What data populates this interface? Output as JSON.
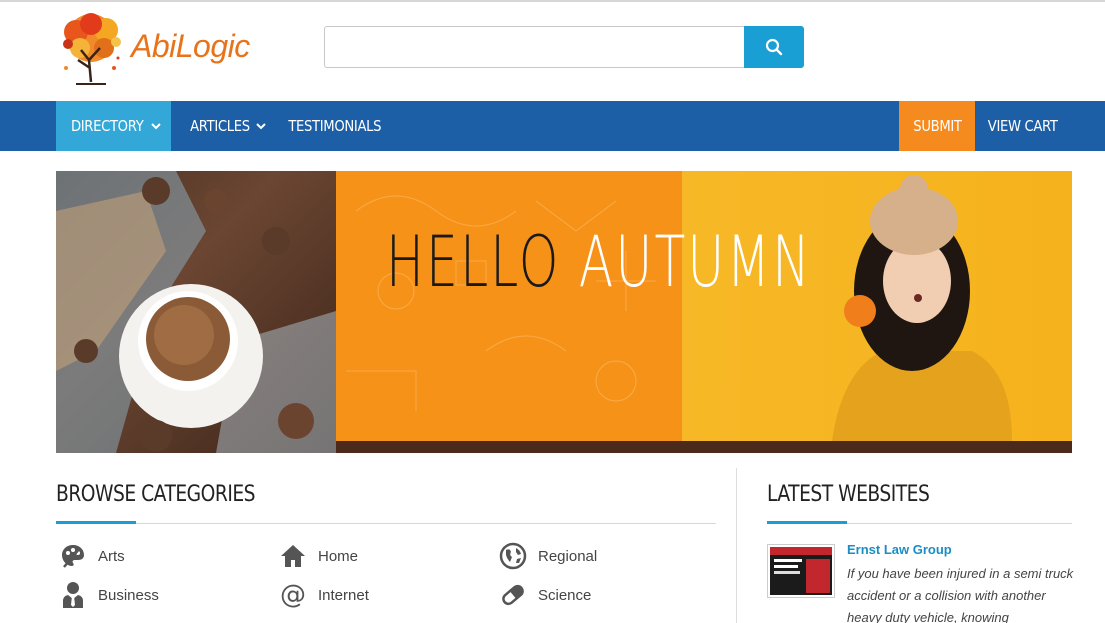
{
  "header": {
    "logo_text": "AbiLogic",
    "search": {
      "value": "",
      "placeholder": "",
      "icon": "search-icon"
    }
  },
  "nav": {
    "items": [
      {
        "label": "DIRECTORY",
        "dropdown": true,
        "active": true
      },
      {
        "label": "ARTICLES",
        "dropdown": true
      },
      {
        "label": "TESTIMONIALS"
      },
      {
        "label": "SUBMIT"
      },
      {
        "label": "VIEW CART"
      }
    ]
  },
  "banner": {
    "word1": "HELLO",
    "word2": "AUTUMN"
  },
  "categories": {
    "title": "BROWSE CATEGORIES",
    "items": [
      {
        "label": "Arts",
        "icon": "palette-icon"
      },
      {
        "label": "Home",
        "icon": "house-icon"
      },
      {
        "label": "Regional",
        "icon": "globe-icon"
      },
      {
        "label": "Business",
        "icon": "businessman-icon"
      },
      {
        "label": "Internet",
        "icon": "at-sign-icon"
      },
      {
        "label": "Science",
        "icon": "pill-icon"
      }
    ]
  },
  "latest": {
    "title": "LATEST WEBSITES",
    "items": [
      {
        "title": "Ernst Law Group",
        "description": "If you have been injured in a semi truck accident or a collision with another heavy duty vehicle, knowing"
      }
    ]
  },
  "colors": {
    "nav_bg": "#1d5fa6",
    "nav_active": "#33a8d8",
    "submit_bg": "#f58a1f",
    "accent": "#1a9fd4",
    "logo_orange": "#e8731a"
  }
}
